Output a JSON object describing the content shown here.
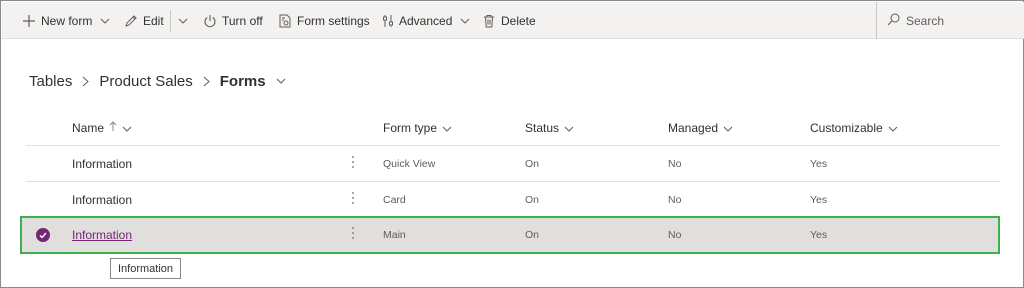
{
  "toolbar": {
    "new_form": "New form",
    "edit": "Edit",
    "turn_off": "Turn off",
    "form_settings": "Form settings",
    "advanced": "Advanced",
    "delete": "Delete",
    "search_placeholder": "Search"
  },
  "breadcrumb": {
    "tables": "Tables",
    "product_sales": "Product Sales",
    "forms": "Forms"
  },
  "grid": {
    "columns": {
      "name": "Name",
      "form_type": "Form type",
      "status": "Status",
      "managed": "Managed",
      "customizable": "Customizable"
    },
    "rows": [
      {
        "name": "Information",
        "form_type": "Quick View",
        "status": "On",
        "managed": "No",
        "customizable": "Yes",
        "selected": false
      },
      {
        "name": "Information",
        "form_type": "Card",
        "status": "On",
        "managed": "No",
        "customizable": "Yes",
        "selected": false
      },
      {
        "name": "Information",
        "form_type": "Main",
        "status": "On",
        "managed": "No",
        "customizable": "Yes",
        "selected": true
      }
    ]
  },
  "tooltip": {
    "text": "Information"
  },
  "colors": {
    "accent": "#742774",
    "selection_outline": "#3fb14a",
    "selected_row_bg": "#e1dfdd",
    "command_bar_bg": "#f3f2f1"
  },
  "icons": [
    "plus-icon",
    "pencil-icon",
    "chevron-down-icon",
    "power-icon",
    "form-settings-icon",
    "advanced-icon",
    "trash-icon",
    "search-icon",
    "chevron-right-icon",
    "arrow-up-icon",
    "checkmark-icon"
  ]
}
